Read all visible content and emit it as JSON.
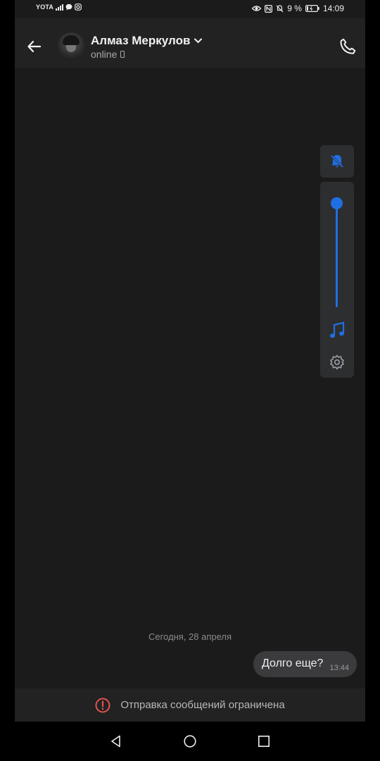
{
  "status_bar": {
    "carrier": "YOTA",
    "battery": "9 %",
    "time": "14:09"
  },
  "header": {
    "contact_name": "Алмаз Меркулов",
    "status": "online"
  },
  "volume_panel": {
    "level": 1.0,
    "icons": [
      "bell-muted-icon",
      "music-note-icon",
      "gear-icon"
    ],
    "accent_color": "#1f6fe3"
  },
  "chat": {
    "date_divider": "Сегодня, 28 апреля",
    "messages": [
      {
        "text": "Долго еще?",
        "time": "13:44",
        "outgoing": true
      }
    ]
  },
  "restriction": {
    "text": "Отправка сообщений ограничена",
    "icon_color": "#e0534f"
  }
}
